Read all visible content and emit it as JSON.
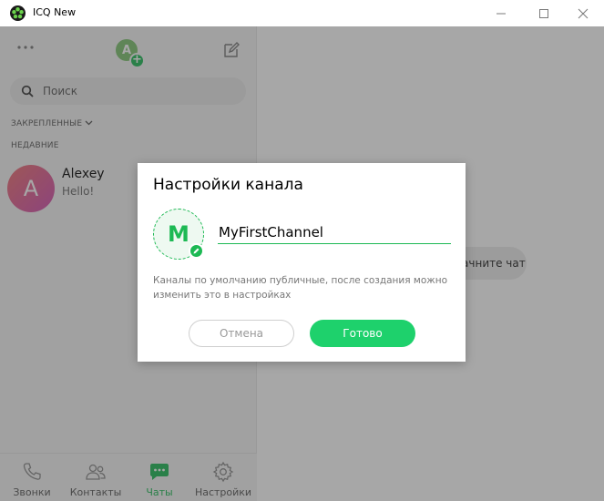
{
  "window": {
    "title": "ICQ New",
    "logo_icon": "icq-flower-icon"
  },
  "sidebar": {
    "avatar_initial": "A",
    "search": {
      "placeholder": "Поиск"
    },
    "pinned_label": "ЗАКРЕПЛЕННЫЕ",
    "recent_label": "НЕДАВНИЕ",
    "chats": [
      {
        "initial": "A",
        "name": "Alexey",
        "preview": "Hello!"
      }
    ]
  },
  "bottom_nav": [
    {
      "label": "Звонки",
      "icon": "phone-icon",
      "active": false
    },
    {
      "label": "Контакты",
      "icon": "contacts-icon",
      "active": false
    },
    {
      "label": "Чаты",
      "icon": "chat-icon",
      "active": true
    },
    {
      "label": "Настройки",
      "icon": "gear-icon",
      "active": false
    }
  ],
  "main": {
    "start_chat_label": "Начните чат"
  },
  "modal": {
    "title": "Настройки канала",
    "avatar_letter": "M",
    "channel_name": "MyFirstChannel",
    "hint": "Каналы по умолчанию публичные, после создания можно изменить это в настройках",
    "cancel_label": "Отмена",
    "done_label": "Готово"
  },
  "colors": {
    "accent": "#1db954",
    "button_green": "#1ed16c"
  }
}
